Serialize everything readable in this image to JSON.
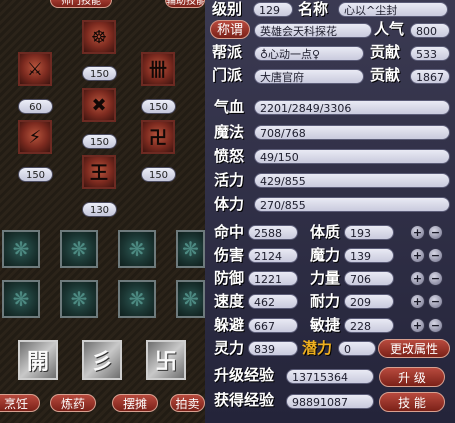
{
  "top_tabs": {
    "left": "师门技能",
    "right": "辅助技能"
  },
  "skills": [
    {
      "name": "skill-1",
      "glyph": "☸",
      "level": "150"
    },
    {
      "name": "skill-2",
      "glyph": "⚔",
      "level": "60"
    },
    {
      "name": "skill-3",
      "glyph": "✖",
      "level": "150"
    },
    {
      "name": "skill-4",
      "glyph": "卌",
      "level": "150"
    },
    {
      "name": "skill-5",
      "glyph": "⚡",
      "level": "150"
    },
    {
      "name": "skill-6",
      "glyph": "卍",
      "level": "150"
    },
    {
      "name": "skill-7",
      "glyph": "王",
      "level": "130"
    }
  ],
  "big_icons": [
    "開",
    "彡",
    "卐"
  ],
  "bottom_tabs": [
    "烹饪",
    "炼药",
    "摆摊",
    "拍卖"
  ],
  "labels": {
    "level": "级别",
    "name": "名称",
    "title_btn": "称谓",
    "popularity": "人气",
    "gang": "帮派",
    "contribution": "贡献",
    "school": "门派",
    "contribution2": "贡献",
    "hp": "气血",
    "mp": "魔法",
    "anger": "愤怒",
    "vitality": "活力",
    "stamina": "体力",
    "hit": "命中",
    "constitution": "体质",
    "damage": "伤害",
    "magic": "魔力",
    "defense": "防御",
    "strength": "力量",
    "speed": "速度",
    "endurance": "耐力",
    "dodge": "躲避",
    "agility": "敏捷",
    "spirit": "灵力",
    "potential": "潜力",
    "exp_up": "升级经验",
    "exp_gain": "获得经验"
  },
  "values": {
    "level": "129",
    "name": "心以^尘封",
    "title": "英雄会天科探花",
    "popularity": "800",
    "gang": "♁心动一点♀",
    "contribution": "533",
    "school": "大唐官府",
    "contribution2": "1867",
    "hp": "2201/2849/3306",
    "mp": "708/768",
    "anger": "49/150",
    "vitality": "429/855",
    "stamina": "270/855",
    "hit": "2588",
    "constitution": "193",
    "damage": "2124",
    "magic": "139",
    "defense": "1221",
    "strength": "706",
    "speed": "462",
    "endurance": "209",
    "dodge": "667",
    "agility": "228",
    "spirit": "839",
    "potential": "0",
    "exp_up": "13715364",
    "exp_gain": "98891087"
  },
  "buttons": {
    "change_attr": "更改属性",
    "upgrade": "升 级",
    "skills": "技 能"
  },
  "plus_minus": {
    "plus": "+",
    "minus": "−"
  }
}
